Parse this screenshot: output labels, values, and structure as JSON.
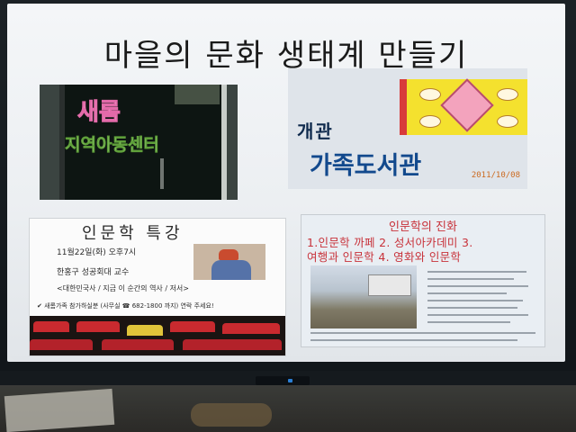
{
  "slide": {
    "title": "마을의 문화 생태계 만들기"
  },
  "panel_signboard": {
    "line1": "새롬",
    "line2": "지역아동센터"
  },
  "panel_library": {
    "line1": "개관",
    "line2": "가족도서관",
    "date_stamp": "2011/10/08"
  },
  "panel_lecture": {
    "title": "인문학 특강",
    "lines": [
      "11월22일(화) 오후7시",
      "한홍구 성공회대 교수",
      "<대한민국사 / 지금 이 순간의 역사 / 저서>",
      "✔ 새롬가족 참가하실분 (사무실 ☎ 682-1800 까지) 연락 주세요!"
    ]
  },
  "panel_evolution": {
    "heading": "인문학의 진화",
    "line1": "1.인문학 까페 2. 성서아카데미 3.",
    "line2": "여행과 인문학 4. 영화와 인문학"
  },
  "colors": {
    "slide_background": "#eef1f4",
    "evolution_text": "#c8323a",
    "library_text": "#12498d"
  }
}
